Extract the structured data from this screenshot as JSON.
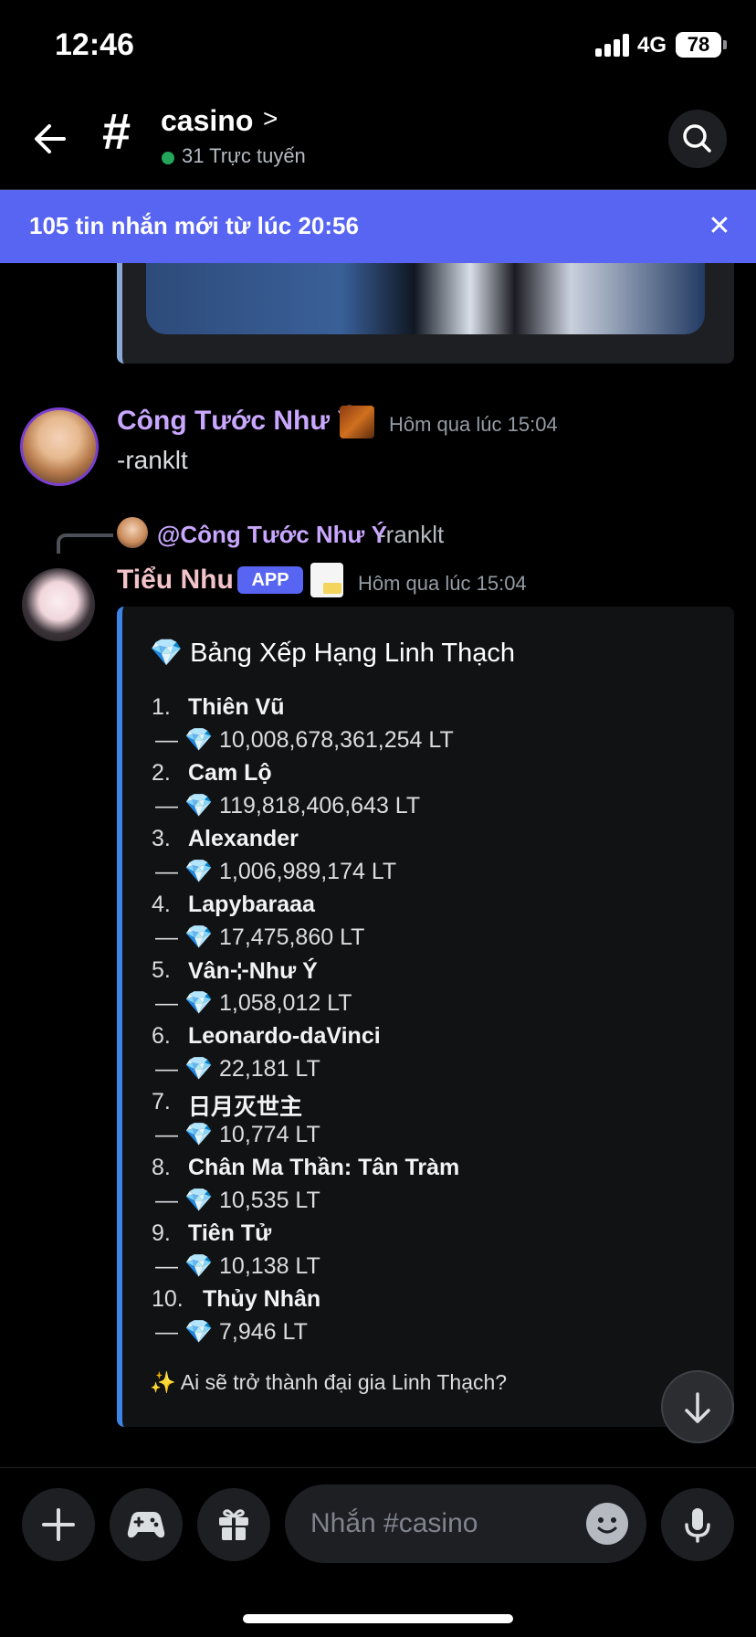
{
  "status_bar": {
    "time": "12:46",
    "network": "4G",
    "battery": "78"
  },
  "header": {
    "hash": "#",
    "channel_name": "casino",
    "chevron": ">",
    "online_text": "31 Trực tuyến"
  },
  "new_messages_bar": {
    "text": "105 tin nhắn mới từ lúc 20:56",
    "close": "✕"
  },
  "messages": [
    {
      "author": "Công Tước Như Ý",
      "time": "Hôm qua lúc 15:04",
      "content": "-ranklt"
    },
    {
      "reply": {
        "author": "@Công Tước Như Ý",
        "content": "-ranklt"
      },
      "author": "Tiểu Nhu",
      "tag": "APP",
      "time": "Hôm qua lúc 15:04",
      "embed": {
        "title": "💎 Bảng Xếp Hạng Linh Thạch",
        "rankings": [
          {
            "rank": "1.",
            "name": "Thiên Vũ",
            "value": "— 💎 10,008,678,361,254 LT"
          },
          {
            "rank": "2.",
            "name": "Cam Lộ",
            "value": "— 💎 119,818,406,643 LT"
          },
          {
            "rank": "3.",
            "name": "Alexander",
            "value": "— 💎 1,006,989,174 LT"
          },
          {
            "rank": "4.",
            "name": "Lapybaraaa",
            "value": "— 💎 17,475,860 LT"
          },
          {
            "rank": "5.",
            "name": "Vân⊹Như Ý",
            "value": "— 💎 1,058,012 LT"
          },
          {
            "rank": "6.",
            "name": "Leonardo-daVinci",
            "value": "— 💎 22,181 LT"
          },
          {
            "rank": "7.",
            "name": "日月灭世主",
            "value": "— 💎 10,774 LT"
          },
          {
            "rank": "8.",
            "name": "Chân Ma Thần: Tân Tràm",
            "value": "— 💎 10,535 LT"
          },
          {
            "rank": "9.",
            "name": "Tiên Tử",
            "value": "— 💎 10,138 LT"
          },
          {
            "rank": "10.",
            "name": "Thủy Nhân",
            "value": "— 💎 7,946 LT"
          }
        ],
        "footer": "✨ Ai sẽ trở thành đại gia Linh Thạch?"
      }
    }
  ],
  "composer": {
    "placeholder": "Nhắn #casino"
  },
  "colors": {
    "accent": "#5865f2",
    "embed_border": "#3c84e6",
    "online": "#23a55a",
    "author1": "#c9a7ff",
    "author2": "#f2c3c9"
  },
  "icons": [
    "back-arrow-icon",
    "search-icon",
    "close-icon",
    "plus-icon",
    "gamepad-icon",
    "gift-icon",
    "emoji-icon",
    "microphone-icon",
    "arrow-down-icon"
  ]
}
